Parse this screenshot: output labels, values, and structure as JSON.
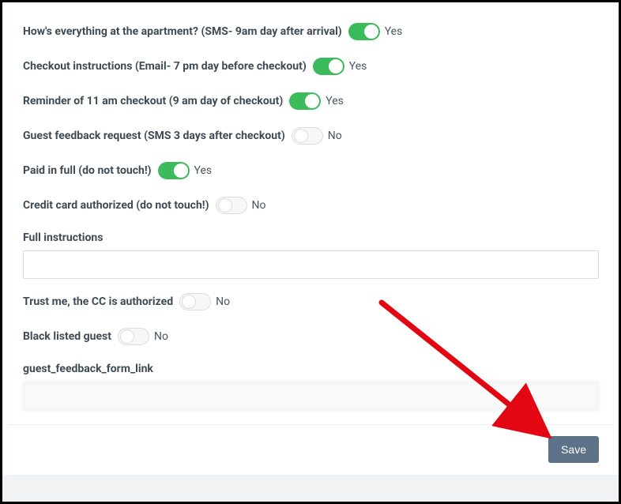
{
  "yes": "Yes",
  "no": "No",
  "rows": {
    "r1": {
      "label": "How's everything at the apartment? (SMS- 9am day after arrival)"
    },
    "r2": {
      "label": "Checkout instructions (Email- 7 pm day before checkout)"
    },
    "r3": {
      "label": "Reminder of 11 am checkout (9 am day of checkout)"
    },
    "r4": {
      "label": "Guest feedback request (SMS 3 days after checkout)"
    },
    "r5": {
      "label": "Paid in full (do not touch!)"
    },
    "r6": {
      "label": "Credit card authorized (do not touch!)"
    },
    "r7": {
      "label": "Full instructions",
      "value": ""
    },
    "r8": {
      "label": "Trust me, the CC is authorized"
    },
    "r9": {
      "label": "Black listed guest"
    },
    "r10": {
      "label": "guest_feedback_form_link",
      "value": ""
    }
  },
  "footer": {
    "save": "Save"
  }
}
